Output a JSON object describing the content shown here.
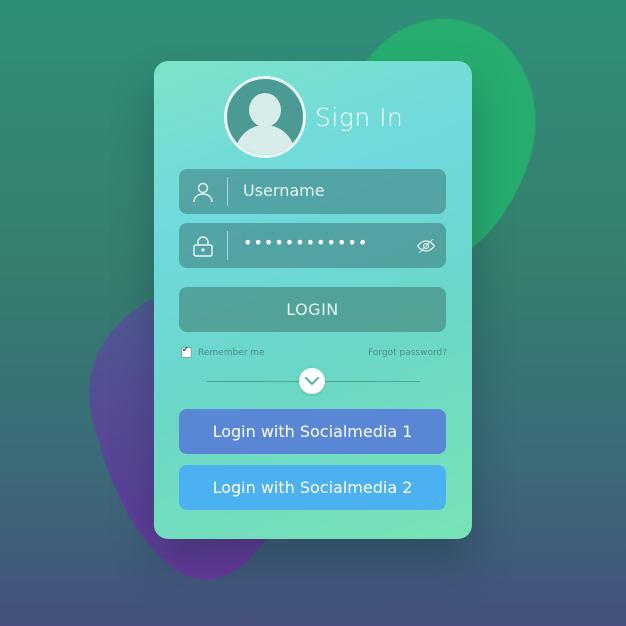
{
  "signin": {
    "title": "Sign In",
    "username_placeholder": "Username",
    "password_masked": "••••••••••••",
    "login_label": "LOGIN",
    "remember_label": "Remember me",
    "forgot_label": "Forgot password?",
    "social_1_label": "Login with Socialmedia 1",
    "social_2_label": "Login with Socialmedia 2"
  },
  "icons": [
    "user-icon",
    "lock-icon",
    "eye-icon",
    "chevron-down-icon"
  ],
  "colors": {
    "social_1": "#5a86d6",
    "social_2": "#4cb1f0"
  }
}
